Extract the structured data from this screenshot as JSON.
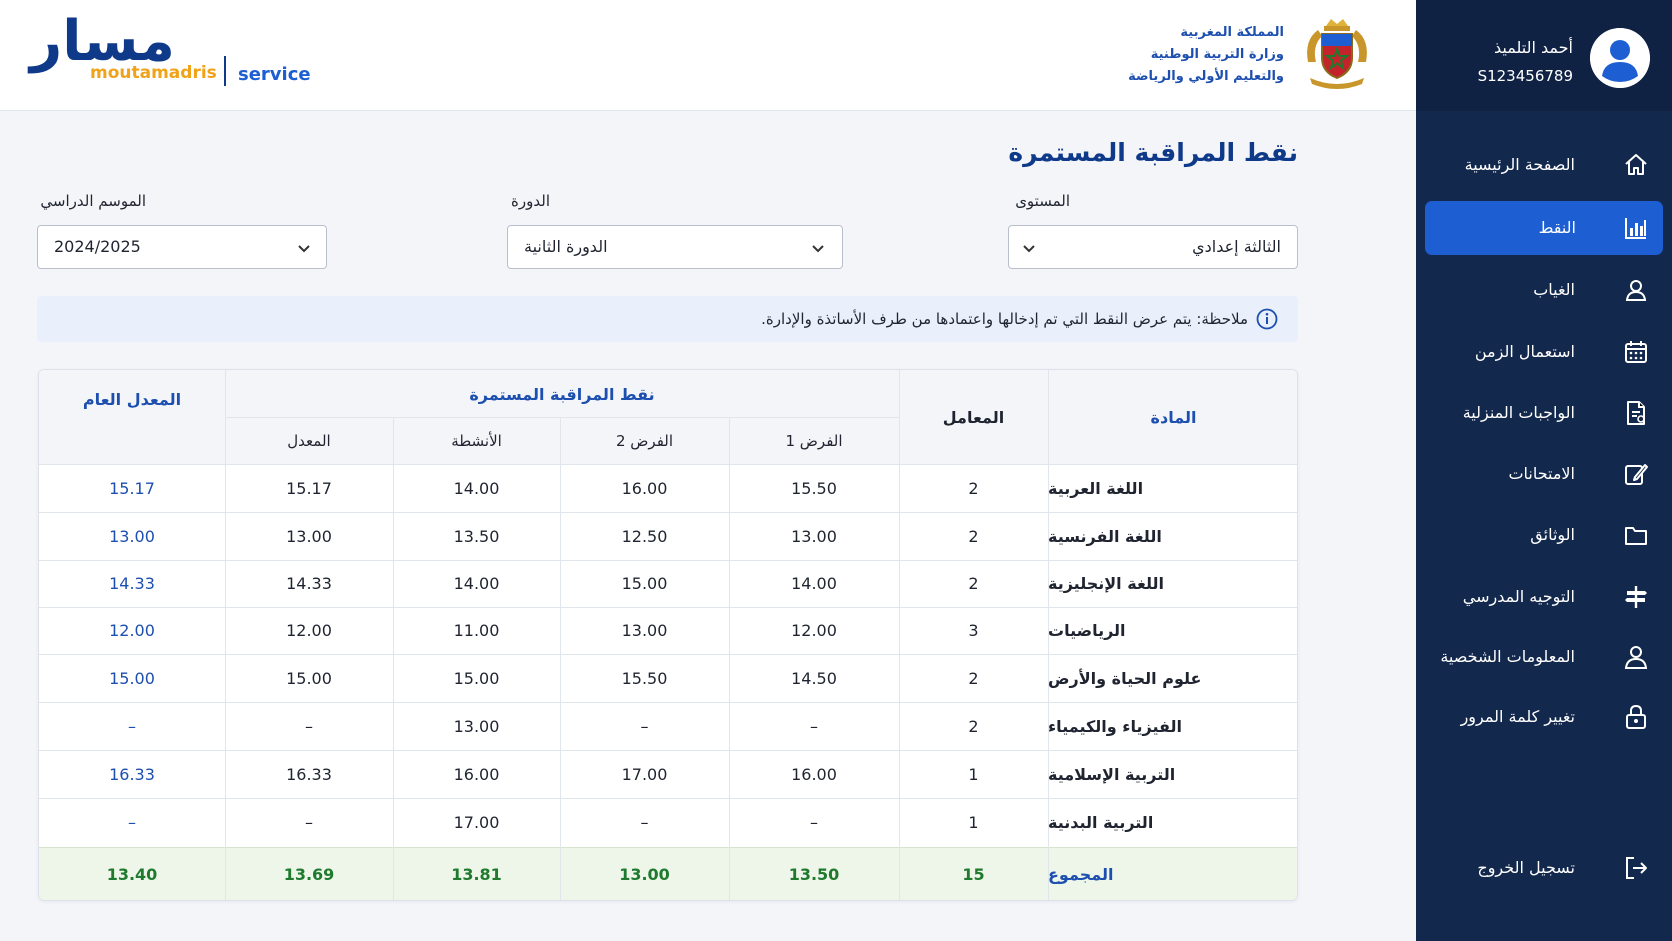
{
  "header": {
    "logo_ar": "مسار",
    "logo_en": "moutamadris",
    "logo_service": "service",
    "ministry_lines": [
      "المملكة المغربية",
      "وزارة التربية الوطنية",
      "والتعليم الأولي والرياضة"
    ]
  },
  "profile": {
    "name": "أحمد التلميذ",
    "id": "S123456789",
    "avatar_icon": "user-avatar-icon"
  },
  "sidebar": {
    "items": [
      {
        "label": "الصفحة الرئيسية",
        "icon": "home-icon",
        "active": false
      },
      {
        "label": "النقط",
        "icon": "bar-chart-icon",
        "active": true
      },
      {
        "label": "الغياب",
        "icon": "user-icon",
        "active": false
      },
      {
        "label": "استعمال الزمن",
        "icon": "calendar-icon",
        "active": false
      },
      {
        "label": "الواجبات المنزلية",
        "icon": "document-icon",
        "active": false
      },
      {
        "label": "الامتحانات",
        "icon": "edit-icon",
        "active": false
      },
      {
        "label": "الوثائق",
        "icon": "folder-icon",
        "active": false
      },
      {
        "label": "التوجيه المدرسي",
        "icon": "signpost-icon",
        "active": false
      },
      {
        "label": "المعلومات الشخصية",
        "icon": "person-icon",
        "active": false
      },
      {
        "label": "تغيير كلمة المرور",
        "icon": "lock-icon",
        "active": false
      }
    ],
    "logout": {
      "label": "تسجيل الخروج",
      "icon": "logout-icon"
    }
  },
  "main": {
    "title": "نقط المراقبة المستمرة",
    "filters": {
      "level": {
        "label": "المستوى",
        "value": "الثالثة إعدادي"
      },
      "term": {
        "label": "الدورة",
        "value": "الدورة الثانية"
      },
      "season": {
        "label": "الموسم الدراسي",
        "value": "2024/2025"
      }
    },
    "note": "ملاحظة: يتم عرض النقط التي تم إدخالها واعتمادها من طرف الأساتذة والإدارة."
  },
  "table": {
    "headers": {
      "subject": "المادة",
      "coef": "المعامل",
      "continuous": "نقط المراقبة المستمرة",
      "general_avg": "المعدل العام",
      "test1": "الفرض 1",
      "test2": "الفرض 2",
      "activities": "الأنشطة",
      "avg": "المعدل"
    },
    "rows": [
      {
        "subject": "اللغة العربية",
        "coef": "2",
        "test1": "15.50",
        "test2": "16.00",
        "activities": "14.00",
        "avg": "15.17",
        "general": "15.17"
      },
      {
        "subject": "اللغة الفرنسية",
        "coef": "2",
        "test1": "13.00",
        "test2": "12.50",
        "activities": "13.50",
        "avg": "13.00",
        "general": "13.00"
      },
      {
        "subject": "اللغة الإنجليزية",
        "coef": "2",
        "test1": "14.00",
        "test2": "15.00",
        "activities": "14.00",
        "avg": "14.33",
        "general": "14.33"
      },
      {
        "subject": "الرياضيات",
        "coef": "3",
        "test1": "12.00",
        "test2": "13.00",
        "activities": "11.00",
        "avg": "12.00",
        "general": "12.00"
      },
      {
        "subject": "علوم الحياة والأرض",
        "coef": "2",
        "test1": "14.50",
        "test2": "15.50",
        "activities": "15.00",
        "avg": "15.00",
        "general": "15.00"
      },
      {
        "subject": "الفيزياء والكيمياء",
        "coef": "2",
        "test1": "–",
        "test2": "–",
        "activities": "13.00",
        "avg": "–",
        "general": "–"
      },
      {
        "subject": "التربية الإسلامية",
        "coef": "1",
        "test1": "16.00",
        "test2": "17.00",
        "activities": "16.00",
        "avg": "16.33",
        "general": "16.33"
      },
      {
        "subject": "التربية البدنية",
        "coef": "1",
        "test1": "–",
        "test2": "–",
        "activities": "17.00",
        "avg": "–",
        "general": "–"
      }
    ],
    "total": {
      "label": "المجموع",
      "coef": "15",
      "test1": "13.50",
      "test2": "13.00",
      "activities": "13.81",
      "avg": "13.69",
      "general": "13.40"
    }
  },
  "colors": {
    "sidebar": "#13284d",
    "active": "#1d5fd3",
    "brand_blue": "#0f3a8a",
    "brand_orange": "#f0a318",
    "total_green": "#1f7a2e"
  }
}
